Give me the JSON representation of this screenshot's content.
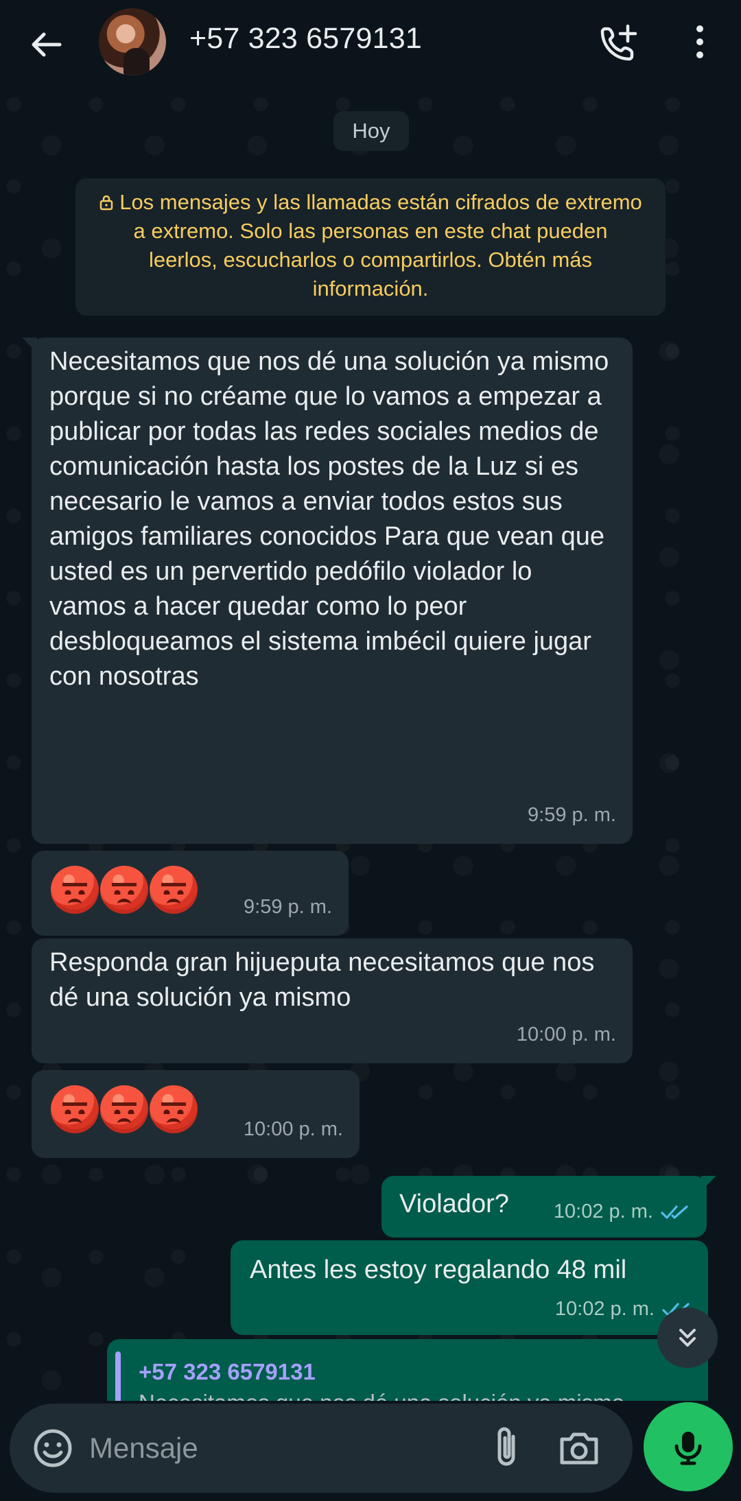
{
  "header": {
    "contact_name": "+57 323 6579131",
    "icons": [
      "back-arrow-icon",
      "add-call-icon",
      "more-vertical-icon"
    ]
  },
  "chat": {
    "date_label": "Hoy",
    "encryption_notice": "Los mensajes y las llamadas están cifrados de extremo a extremo. Solo las personas en este chat pueden leerlos, escucharlos o compartirlos. Obtén más información.",
    "messages": [
      {
        "direction": "incoming",
        "text": "Necesitamos que nos dé una solución ya mismo porque si no créame que lo vamos a empezar a publicar por todas las redes sociales medios de comunicación hasta los postes de la Luz si es necesario le vamos a enviar todos estos sus amigos familiares conocidos Para que vean que usted es un pervertido pedófilo violador lo vamos a hacer quedar como lo peor desbloqueamos el sistema imbécil quiere jugar con nosotras",
        "time": "9:59 p. m."
      },
      {
        "direction": "incoming",
        "emoji": "😡😡😡",
        "time": "9:59 p. m."
      },
      {
        "direction": "incoming",
        "text": "Responda gran hijueputa necesitamos que nos dé una solución ya mismo",
        "time": "10:00 p. m."
      },
      {
        "direction": "incoming",
        "emoji": "😡😡😡",
        "time": "10:00 p. m."
      },
      {
        "direction": "outgoing",
        "text": "Violador?",
        "time": "10:02 p. m.",
        "status": "read"
      },
      {
        "direction": "outgoing",
        "text": "Antes les estoy regalando 48 mil",
        "time": "10:02 p. m.",
        "status": "read"
      },
      {
        "direction": "outgoing",
        "reply_author": "+57 323 6579131",
        "reply_text": "Necesitamos que nos dé una solución ya mismo porque si no créame que lo vamos a empezar a publicar por todas las redes soc…"
      }
    ]
  },
  "composer": {
    "placeholder": "Mensaje",
    "icons": [
      "emoji-icon",
      "attach-icon",
      "camera-icon",
      "mic-icon"
    ]
  },
  "colors": {
    "background": "#0b141a",
    "incoming_bubble": "#202c33",
    "outgoing_bubble": "#005c4b",
    "notice_text": "#f7cd5f",
    "accent_green": "#21c063",
    "read_ticks": "#53bdeb"
  }
}
